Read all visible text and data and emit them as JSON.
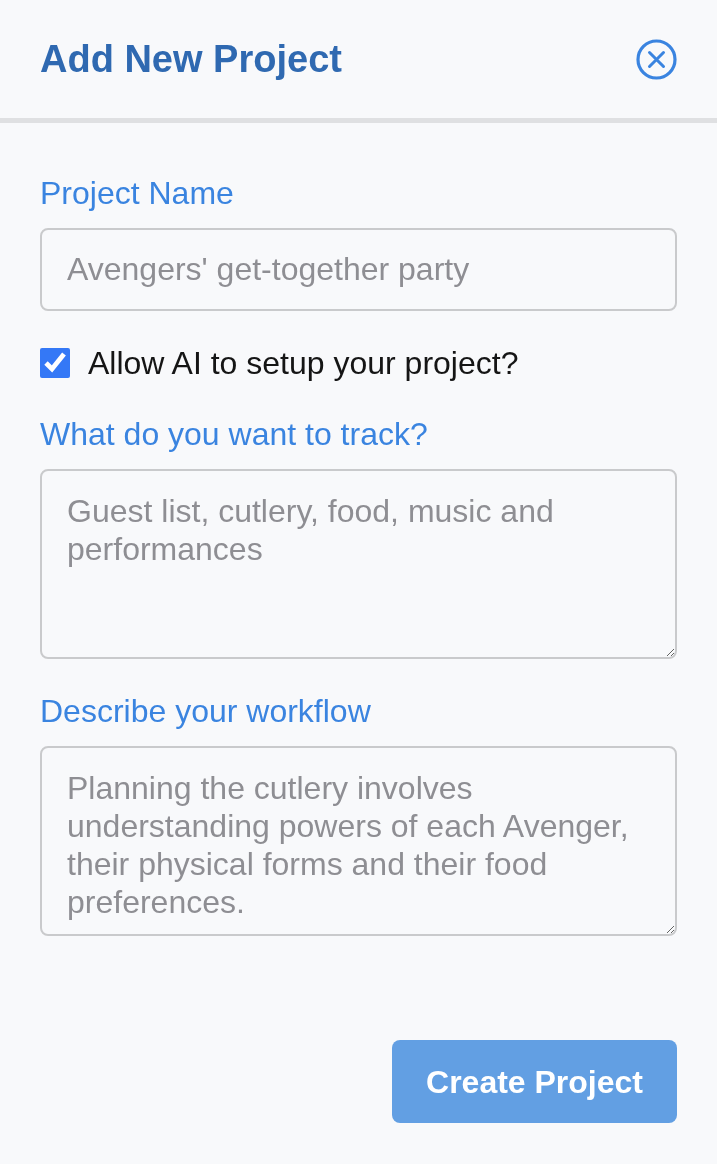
{
  "header": {
    "title": "Add New Project"
  },
  "form": [
    {
      "kind": "input",
      "label": "Project Name",
      "placeholder": "Avengers' get-together party"
    },
    {
      "kind": "checkbox",
      "label": "Allow AI to setup your project?",
      "checked": true
    },
    {
      "kind": "textarea",
      "label": "What do you want to track?",
      "placeholder": "Guest list, cutlery, food, music and performances"
    },
    {
      "kind": "textarea",
      "label": "Describe your workflow",
      "placeholder": "Planning the cutlery involves understanding powers of each Avenger, their physical forms and their food preferences."
    }
  ],
  "submit_button": {
    "label": "Create Project"
  }
}
